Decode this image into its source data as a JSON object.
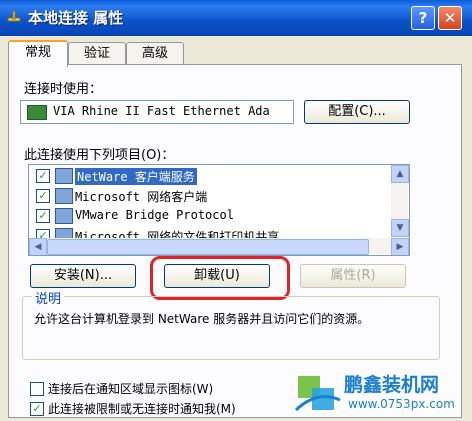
{
  "window": {
    "title": "本地连接 属性",
    "help_label": "?",
    "close_label": "✕"
  },
  "tabs": [
    {
      "label": "常规"
    },
    {
      "label": "验证"
    },
    {
      "label": "高级"
    }
  ],
  "connect_using": {
    "label": "连接时使用：",
    "adapter_name": "VIA Rhine II Fast Ethernet Ada",
    "configure_label": "配置(C)..."
  },
  "items_section": {
    "label": "此连接使用下列项目(O)：",
    "items": [
      {
        "label": "NetWare 客户端服务",
        "checked": true,
        "selected": true
      },
      {
        "label": "Microsoft 网络客户端",
        "checked": true,
        "selected": false
      },
      {
        "label": "VMware Bridge Protocol",
        "checked": true,
        "selected": false
      },
      {
        "label": "Microsoft 网络的文件和打印机共享",
        "checked": true,
        "selected": false
      }
    ]
  },
  "actions": {
    "install_label": "安装(N)...",
    "uninstall_label": "卸载(U)",
    "properties_label": "属性(R)"
  },
  "description": {
    "title": "说明",
    "text": "允许这台计算机登录到 NetWare 服务器并且访问它们的资源。"
  },
  "options": [
    {
      "label": "连接后在通知区域显示图标(W)",
      "checked": false
    },
    {
      "label": "此连接被限制或无连接时通知我(M)",
      "checked": true
    }
  ],
  "watermark": {
    "name": "鹏鑫装机网",
    "url": "www.0753px.com"
  }
}
